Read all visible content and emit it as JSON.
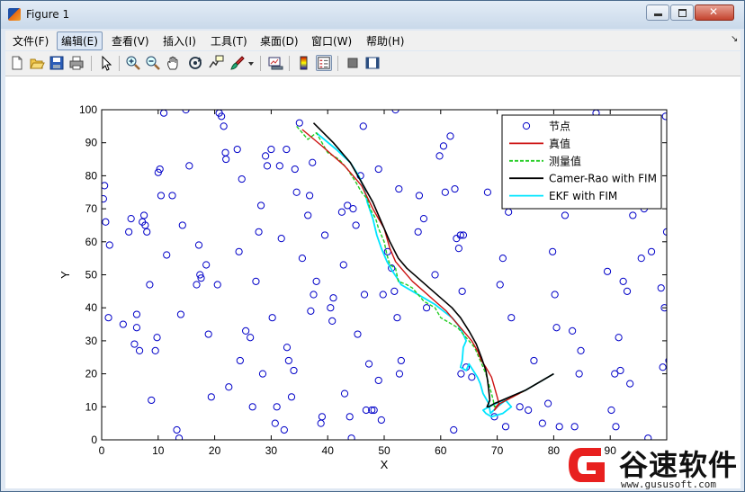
{
  "window": {
    "title": "Figure 1"
  },
  "menu": {
    "items": [
      "文件(F)",
      "编辑(E)",
      "查看(V)",
      "插入(I)",
      "工具(T)",
      "桌面(D)",
      "窗口(W)",
      "帮助(H)"
    ],
    "active_index": 1
  },
  "toolbar": {
    "icons": [
      "new-figure-icon",
      "open-file-icon",
      "save-icon",
      "print-icon",
      "pointer-icon",
      "zoom-in-icon",
      "zoom-out-icon",
      "pan-icon",
      "rotate-3d-icon",
      "data-cursor-icon",
      "brush-icon",
      "brush-dropdown-icon",
      "link-plot-icon",
      "colorbar-icon",
      "legend-icon",
      "hide-plot-tools-icon",
      "show-plot-tools-icon"
    ]
  },
  "chart_data": {
    "type": "scatter",
    "xlabel": "X",
    "ylabel": "Y",
    "xlim": [
      0,
      100
    ],
    "ylim": [
      0,
      100
    ],
    "xticks": [
      0,
      10,
      20,
      30,
      40,
      50,
      60,
      70,
      80,
      90
    ],
    "yticks": [
      0,
      10,
      20,
      30,
      40,
      50,
      60,
      70,
      80,
      90,
      100
    ],
    "grid": false,
    "legend_position": "top-right",
    "legend": [
      {
        "label": "节点",
        "style": "circle",
        "color": "#0000c8"
      },
      {
        "label": "真值",
        "style": "solid",
        "color": "#cc1111"
      },
      {
        "label": "测量值",
        "style": "dashed",
        "color": "#22cc22"
      },
      {
        "label": "Camer-Rao with FIM",
        "style": "solid",
        "color": "#000000"
      },
      {
        "label": "EKF with FIM",
        "style": "solid",
        "color": "#00e5ff"
      }
    ],
    "nodes": [
      [
        0.5,
        77
      ],
      [
        0.3,
        73
      ],
      [
        0.7,
        66
      ],
      [
        1.4,
        59
      ],
      [
        1.2,
        37
      ],
      [
        3.8,
        35
      ],
      [
        4.8,
        63
      ],
      [
        5.2,
        67
      ],
      [
        5.8,
        29
      ],
      [
        6.2,
        34
      ],
      [
        6.2,
        38
      ],
      [
        6.7,
        27
      ],
      [
        7.2,
        66
      ],
      [
        7.5,
        68
      ],
      [
        7.7,
        65
      ],
      [
        8.0,
        63
      ],
      [
        8.5,
        47
      ],
      [
        8.8,
        12
      ],
      [
        9.5,
        27
      ],
      [
        9.8,
        31
      ],
      [
        10,
        81
      ],
      [
        10.3,
        82
      ],
      [
        10.5,
        74
      ],
      [
        11,
        99
      ],
      [
        11.5,
        56
      ],
      [
        12.5,
        74
      ],
      [
        13.3,
        3
      ],
      [
        13.7,
        0.5
      ],
      [
        14,
        38
      ],
      [
        14.3,
        65
      ],
      [
        14.9,
        100
      ],
      [
        15.5,
        83
      ],
      [
        16.8,
        47
      ],
      [
        17.2,
        59
      ],
      [
        17.4,
        50
      ],
      [
        17.6,
        49
      ],
      [
        18.5,
        53
      ],
      [
        18.9,
        32
      ],
      [
        19.4,
        13
      ],
      [
        20.5,
        47
      ],
      [
        20.8,
        99
      ],
      [
        21.2,
        98
      ],
      [
        21.6,
        95
      ],
      [
        21.9,
        87
      ],
      [
        22,
        85
      ],
      [
        22.5,
        16
      ],
      [
        24,
        88
      ],
      [
        24.3,
        57
      ],
      [
        24.5,
        24
      ],
      [
        24.8,
        79
      ],
      [
        25.5,
        33
      ],
      [
        26.3,
        31
      ],
      [
        26.7,
        10
      ],
      [
        27.3,
        48
      ],
      [
        27.8,
        63
      ],
      [
        28.2,
        71
      ],
      [
        28.5,
        20
      ],
      [
        29,
        86
      ],
      [
        29.3,
        83
      ],
      [
        30,
        88
      ],
      [
        30.2,
        37
      ],
      [
        30.7,
        5
      ],
      [
        31.0,
        10
      ],
      [
        31.5,
        83
      ],
      [
        31.8,
        61
      ],
      [
        32.3,
        3
      ],
      [
        32.7,
        88
      ],
      [
        32.8,
        28
      ],
      [
        33.1,
        24
      ],
      [
        33.6,
        13
      ],
      [
        34,
        21
      ],
      [
        34.2,
        82
      ],
      [
        34.5,
        75
      ],
      [
        35,
        96
      ],
      [
        35.5,
        55
      ],
      [
        36.5,
        68
      ],
      [
        36.8,
        74
      ],
      [
        37,
        39
      ],
      [
        37.3,
        84
      ],
      [
        37.5,
        44
      ],
      [
        38,
        48
      ],
      [
        38.8,
        5
      ],
      [
        39,
        7
      ],
      [
        39.5,
        62
      ],
      [
        40.5,
        40
      ],
      [
        41,
        43
      ],
      [
        40.8,
        36
      ],
      [
        42.5,
        69
      ],
      [
        42.8,
        53
      ],
      [
        43,
        14
      ],
      [
        43.5,
        71
      ],
      [
        43.9,
        7
      ],
      [
        44.2,
        0.5
      ],
      [
        44.5,
        70
      ],
      [
        45,
        65
      ],
      [
        45.3,
        32
      ],
      [
        45.8,
        80
      ],
      [
        46.3,
        95
      ],
      [
        46.5,
        44
      ],
      [
        46.8,
        9
      ],
      [
        47.3,
        23
      ],
      [
        47.8,
        9
      ],
      [
        48.2,
        9
      ],
      [
        49,
        18
      ],
      [
        49,
        82
      ],
      [
        49.5,
        6
      ],
      [
        49.8,
        44
      ],
      [
        50.6,
        57
      ],
      [
        51.3,
        52
      ],
      [
        51.8,
        45
      ],
      [
        52,
        100
      ],
      [
        52.3,
        37
      ],
      [
        52.6,
        76
      ],
      [
        52.7,
        20
      ],
      [
        53,
        24
      ],
      [
        56,
        63
      ],
      [
        56.2,
        74
      ],
      [
        57,
        67
      ],
      [
        57.5,
        40
      ],
      [
        59,
        50
      ],
      [
        59.8,
        86
      ],
      [
        60.5,
        89
      ],
      [
        60.8,
        75
      ],
      [
        61.7,
        92
      ],
      [
        62.3,
        3
      ],
      [
        62.5,
        76
      ],
      [
        62.8,
        61
      ],
      [
        63.2,
        58
      ],
      [
        63.5,
        62
      ],
      [
        63.6,
        20
      ],
      [
        63.8,
        45
      ],
      [
        64.0,
        62
      ],
      [
        64.5,
        22
      ],
      [
        65.5,
        19
      ],
      [
        68.3,
        75
      ],
      [
        69.5,
        7
      ],
      [
        70.5,
        47
      ],
      [
        71,
        55
      ],
      [
        71.5,
        4
      ],
      [
        72,
        69
      ],
      [
        72.5,
        37
      ],
      [
        73,
        90
      ],
      [
        74,
        10
      ],
      [
        75.5,
        9
      ],
      [
        76,
        89
      ],
      [
        76.5,
        24
      ],
      [
        78,
        5
      ],
      [
        79,
        11
      ],
      [
        79.8,
        57
      ],
      [
        80.2,
        44
      ],
      [
        80.5,
        34
      ],
      [
        81,
        4
      ],
      [
        82,
        68
      ],
      [
        83.3,
        33
      ],
      [
        83.7,
        4
      ],
      [
        84.5,
        20
      ],
      [
        84.8,
        27
      ],
      [
        85,
        72
      ],
      [
        87.5,
        99
      ],
      [
        89.5,
        51
      ],
      [
        90.2,
        9
      ],
      [
        90.8,
        20
      ],
      [
        91,
        4
      ],
      [
        91.5,
        31
      ],
      [
        91.8,
        21
      ],
      [
        92.3,
        48
      ],
      [
        93,
        45
      ],
      [
        93.5,
        17
      ],
      [
        94,
        68
      ],
      [
        95.5,
        55
      ],
      [
        96,
        70
      ],
      [
        96.7,
        0.5
      ],
      [
        97.3,
        57
      ],
      [
        99,
        46
      ],
      [
        99.3,
        22
      ],
      [
        99.6,
        40
      ],
      [
        99.8,
        98
      ],
      [
        100,
        63
      ],
      [
        100.4,
        24
      ],
      [
        100.6,
        7
      ],
      [
        100.9,
        39
      ]
    ],
    "series": [
      {
        "name": "真值",
        "color": "#cc1111",
        "x": [
          35.5,
          39,
          43,
          46,
          48,
          50,
          51,
          52,
          53,
          55,
          57,
          59,
          61,
          62.5,
          64,
          65.5,
          66.5,
          67.2,
          68,
          69,
          69.5,
          70,
          70.3,
          69.8,
          69.5,
          70.5,
          75,
          80
        ],
        "y": [
          94,
          89,
          83,
          77,
          70,
          64,
          58,
          54,
          52,
          48,
          45,
          42,
          39,
          36,
          33,
          30,
          27,
          24,
          22,
          19,
          16,
          13,
          11,
          10,
          9,
          11,
          15,
          20
        ]
      },
      {
        "name": "测量值",
        "color": "#22cc22",
        "x": [
          34.5,
          36.5,
          38,
          40,
          42,
          43.5,
          45,
          46,
          47,
          47.5,
          48.5,
          49,
          50,
          50.5,
          51,
          52,
          52.5,
          54,
          55,
          56,
          57,
          58,
          59,
          60,
          61,
          62,
          63,
          64,
          65,
          65.5,
          66,
          66.5,
          67,
          67.5,
          68,
          68.5,
          69,
          69.3,
          69.5,
          70.5,
          75,
          80
        ],
        "y": [
          95,
          91,
          93,
          87,
          85,
          82,
          78,
          75,
          73,
          70,
          67,
          64,
          60,
          56,
          53,
          52,
          48,
          47,
          46,
          44,
          42,
          41,
          40,
          37,
          36,
          35,
          34,
          32,
          30,
          29,
          28,
          26,
          24,
          22,
          20,
          17,
          14,
          12,
          10,
          11,
          15,
          20
        ]
      },
      {
        "name": "Camer-Rao with FIM",
        "color": "#000000",
        "x": [
          37.5,
          41,
          44,
          46,
          48,
          49.5,
          51,
          52.5,
          54,
          56,
          58,
          60,
          62,
          63.5,
          65,
          66.3,
          67.2,
          68,
          68.3,
          68.5,
          68.7,
          68.2,
          68.5,
          69.5,
          75,
          80
        ],
        "y": [
          96,
          90,
          84,
          78,
          72,
          66,
          60,
          55,
          52,
          49,
          46,
          43,
          40,
          37,
          33,
          29,
          25,
          21,
          18,
          15,
          12,
          10,
          10,
          11,
          15,
          20
        ]
      },
      {
        "name": "EKF with FIM",
        "color": "#00e5ff",
        "x": [
          38,
          41.5,
          44,
          45.5,
          46.5,
          47,
          48,
          48.7,
          49.5,
          50.5,
          51.5,
          52.3,
          53,
          55,
          57,
          59,
          60.5,
          62,
          63,
          64,
          64.5,
          64,
          63.8,
          63.5,
          64.5,
          65,
          66.5,
          67,
          67.5,
          68.5,
          68.8,
          70,
          71.5,
          72.5,
          71,
          69,
          68,
          67.5,
          68.5,
          71,
          75,
          80
        ],
        "y": [
          93,
          88,
          84,
          80,
          76,
          72,
          67,
          62,
          58,
          54,
          51,
          49,
          47,
          45,
          43,
          41,
          39,
          37,
          35,
          32,
          30,
          28,
          24,
          22,
          21,
          23,
          19,
          17,
          14,
          11,
          8,
          10,
          12,
          10,
          8,
          7,
          8,
          9,
          10,
          12,
          15,
          20
        ]
      }
    ]
  },
  "watermark": {
    "name": "谷速软件",
    "url": "www.gususoft.com"
  }
}
